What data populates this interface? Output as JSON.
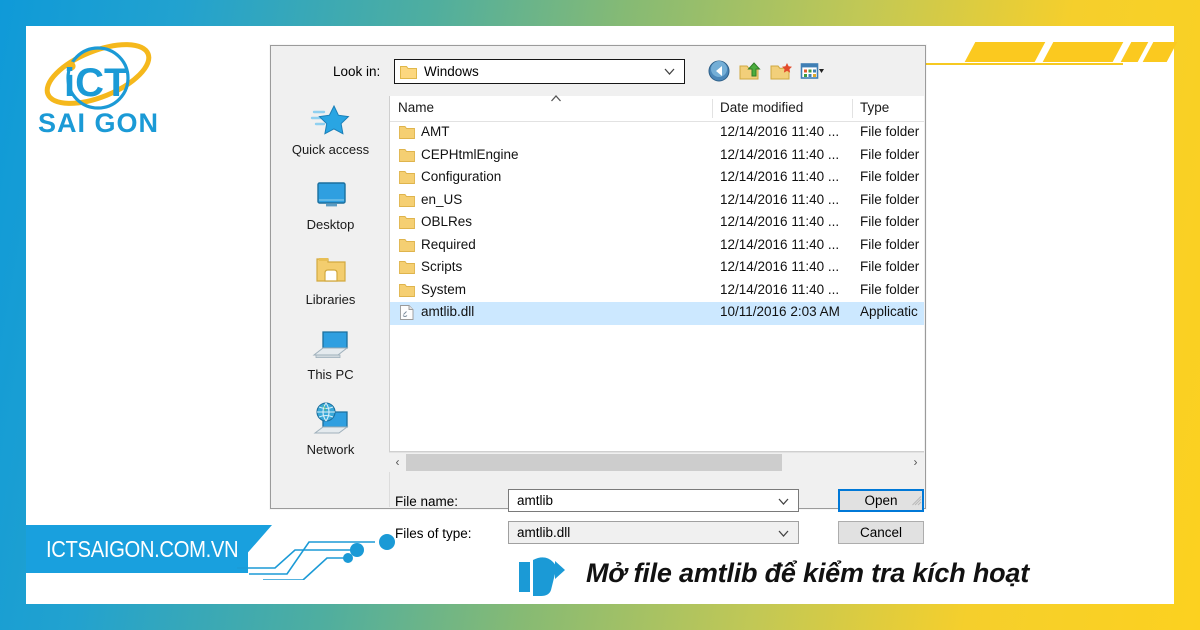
{
  "brand": {
    "logo_text_main": "iCT",
    "logo_text_sub": "SAI GON",
    "ribbon_url": "ICTSAIGON.COM.VN"
  },
  "caption": {
    "text": "Mở file amtlib để kiểm tra kích hoạt",
    "hand_icon": "pointing-hand-icon"
  },
  "dialog": {
    "lookin": {
      "label": "Look in:",
      "value": "Windows",
      "folder_icon": "folder-icon",
      "dropdown_icon": "chevron-down-icon"
    },
    "toolbar": [
      {
        "name": "back-button",
        "icon": "back-arrow-icon"
      },
      {
        "name": "up-one-level-button",
        "icon": "up-folder-icon"
      },
      {
        "name": "new-folder-button",
        "icon": "new-folder-icon"
      },
      {
        "name": "views-button",
        "icon": "views-grid-icon"
      }
    ],
    "places": [
      {
        "label": "Quick access",
        "icon": "star-icon"
      },
      {
        "label": "Desktop",
        "icon": "monitor-icon"
      },
      {
        "label": "Libraries",
        "icon": "libraries-folder-icon"
      },
      {
        "label": "This PC",
        "icon": "computer-icon"
      },
      {
        "label": "Network",
        "icon": "network-globe-icon"
      }
    ],
    "columns": {
      "name": "Name",
      "date_modified": "Date modified",
      "type": "Type",
      "sort_indicator": "sort-ascending-icon"
    },
    "files": [
      {
        "name": "AMT",
        "date": "12/14/2016 11:40 ...",
        "type": "File folder",
        "icon": "folder-icon",
        "selected": false
      },
      {
        "name": "CEPHtmlEngine",
        "date": "12/14/2016 11:40 ...",
        "type": "File folder",
        "icon": "folder-icon",
        "selected": false
      },
      {
        "name": "Configuration",
        "date": "12/14/2016 11:40 ...",
        "type": "File folder",
        "icon": "folder-icon",
        "selected": false
      },
      {
        "name": "en_US",
        "date": "12/14/2016 11:40 ...",
        "type": "File folder",
        "icon": "folder-icon",
        "selected": false
      },
      {
        "name": "OBLRes",
        "date": "12/14/2016 11:40 ...",
        "type": "File folder",
        "icon": "folder-icon",
        "selected": false
      },
      {
        "name": "Required",
        "date": "12/14/2016 11:40 ...",
        "type": "File folder",
        "icon": "folder-icon",
        "selected": false
      },
      {
        "name": "Scripts",
        "date": "12/14/2016 11:40 ...",
        "type": "File folder",
        "icon": "folder-icon",
        "selected": false
      },
      {
        "name": "System",
        "date": "12/14/2016 11:40 ...",
        "type": "File folder",
        "icon": "folder-icon",
        "selected": false
      },
      {
        "name": "amtlib.dll",
        "date": "10/11/2016 2:03 AM",
        "type": "Applicatic",
        "icon": "dll-file-icon",
        "selected": true
      }
    ],
    "scrollbar": {
      "left_arrow": "‹",
      "right_arrow": "›",
      "thumb_percent": 75
    },
    "filename": {
      "label": "File name:",
      "value": "amtlib",
      "dropdown_icon": "chevron-down-icon"
    },
    "filetype": {
      "label": "Files of type:",
      "value": "amtlib.dll",
      "dropdown_icon": "chevron-down-icon"
    },
    "buttons": {
      "open": "Open",
      "cancel": "Cancel"
    }
  },
  "colors": {
    "brand_blue": "#19a0de",
    "brand_yellow": "#fbc91f",
    "selection_blue": "#cce8ff",
    "focus_blue": "#0078d7"
  }
}
